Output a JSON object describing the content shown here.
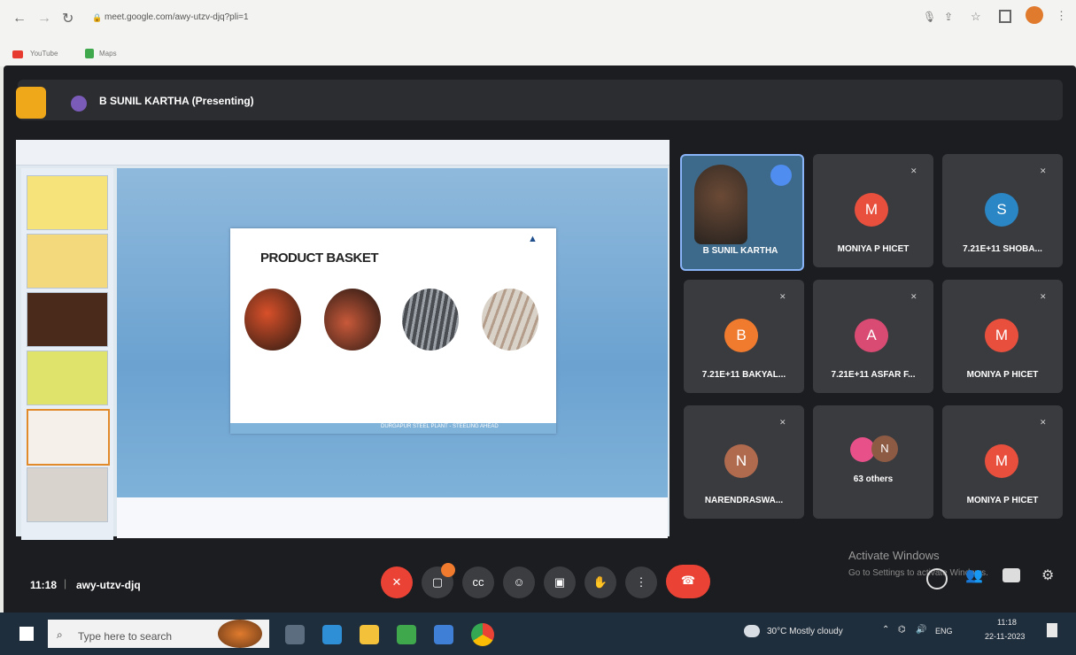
{
  "browser": {
    "url": "meet.google.com/awy-utzv-djq?pli=1",
    "bookmarks": [
      "YouTube",
      "Maps"
    ]
  },
  "meet": {
    "presenter_label": "B SUNIL KARTHA (Presenting)",
    "meeting_code": "awy-utzv-djq",
    "time": "11:18",
    "others_label": "63 others",
    "activate_title": "Activate Windows",
    "activate_sub": "Go to Settings to activate Windows.",
    "participants": [
      {
        "name": "B SUNIL KARTHA",
        "initial": "",
        "color": "#3d6a8a",
        "video": true
      },
      {
        "name": "MONIYA P HICET",
        "initial": "M",
        "color": "#e8503d"
      },
      {
        "name": "7.21E+11 SHOBA...",
        "initial": "S",
        "color": "#2a86c4"
      },
      {
        "name": "7.21E+11 BAKYAL...",
        "initial": "B",
        "color": "#f07b2e"
      },
      {
        "name": "7.21E+11 ASFAR F...",
        "initial": "A",
        "color": "#d94b72"
      },
      {
        "name": "MONIYA P HICET",
        "initial": "M",
        "color": "#e8503d"
      },
      {
        "name": "NARENDRASWA...",
        "initial": "N",
        "color": "#b06a4d"
      },
      {
        "name": "63 others",
        "initial": "N",
        "color": "#8d5a44"
      },
      {
        "name": "MONIYA P HICET",
        "initial": "M",
        "color": "#e8503d"
      }
    ]
  },
  "slide": {
    "title": "PRODUCT BASKET",
    "footer": "DURGAPUR STEEL PLANT - STEELING AHEAD"
  },
  "taskbar": {
    "search_placeholder": "Type here to search",
    "weather": "30°C  Mostly cloudy",
    "lang": "ENG",
    "time": "11:18",
    "date": "22-11-2023"
  }
}
